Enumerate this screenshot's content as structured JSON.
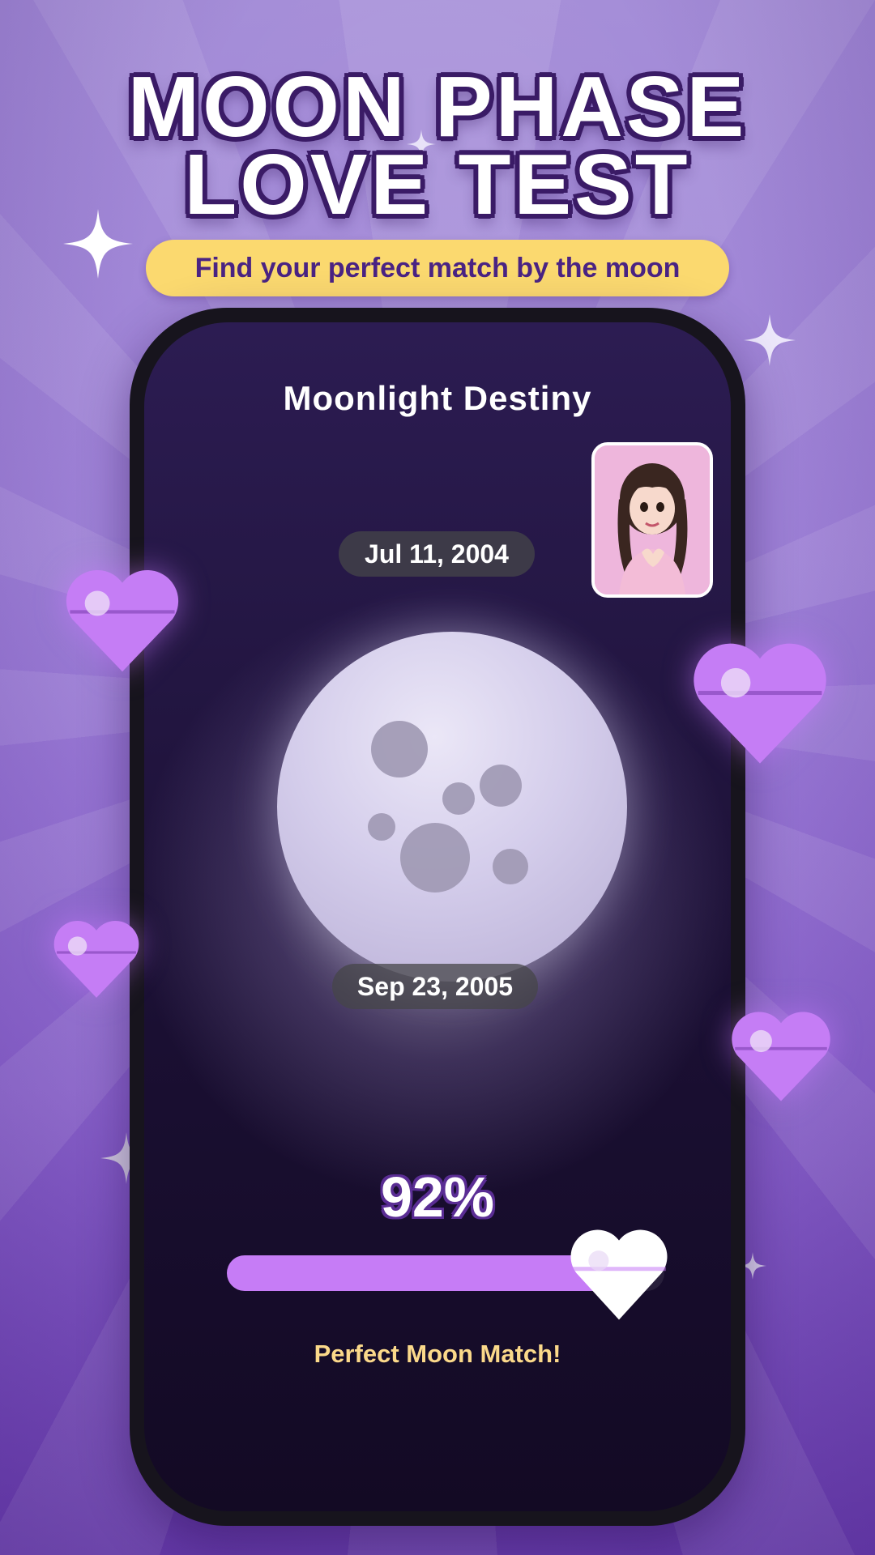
{
  "header": {
    "title_line1": "MOON PHASE",
    "title_line2": "LOVE TEST",
    "subtitle": "Find your perfect match by the moon"
  },
  "app": {
    "title": "Moonlight Destiny",
    "date_top": "Jul 11, 2004",
    "date_bottom": "Sep 23, 2005",
    "match_percent_text": "92%",
    "match_fraction": 0.92,
    "match_label": "Perfect Moon Match!"
  },
  "colors": {
    "accent_purple": "#c67cf6",
    "subtitle_pill": "#fbd96f",
    "title_outline": "#3a1b66",
    "match_text": "#fbd98a"
  },
  "icons": {
    "heart": "heart-icon",
    "sparkle": "sparkle-icon",
    "moon": "moon-icon",
    "avatar": "avatar-photo"
  }
}
